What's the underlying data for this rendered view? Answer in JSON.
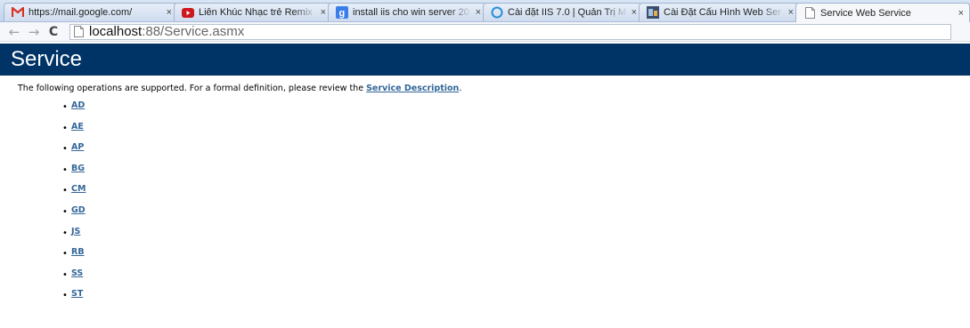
{
  "tabs": [
    {
      "title": "https://mail.google.com/",
      "icon": "gmail-icon",
      "close": "×"
    },
    {
      "title": "Liên Khúc Nhạc trẻ Remix",
      "icon": "youtube-icon",
      "close": "×"
    },
    {
      "title": "install iis cho win server 20",
      "icon": "google-icon",
      "close": "×"
    },
    {
      "title": "Cài đặt IIS 7.0 | Quản Trị M",
      "icon": "globe-icon",
      "close": "×"
    },
    {
      "title": "Cài Đặt Cấu Hình Web Ser",
      "icon": "site-icon",
      "close": "×"
    },
    {
      "title": "Service Web Service",
      "icon": "page-icon",
      "close": "×",
      "active": true
    }
  ],
  "toolbar": {
    "back": "←",
    "forward": "→",
    "reload": "C",
    "url_host": "localhost",
    "url_rest": ":88/Service.asmx"
  },
  "page": {
    "banner_title": "Service",
    "intro_text": "The following operations are supported. For a formal definition, please review the ",
    "intro_link": "Service Description",
    "intro_end": ".",
    "operations": [
      "AD",
      "AE",
      "AP",
      "BG",
      "CM",
      "GD",
      "JS",
      "RB",
      "SS",
      "ST"
    ]
  },
  "colors": {
    "banner_bg": "#003366",
    "link": "#336699"
  }
}
